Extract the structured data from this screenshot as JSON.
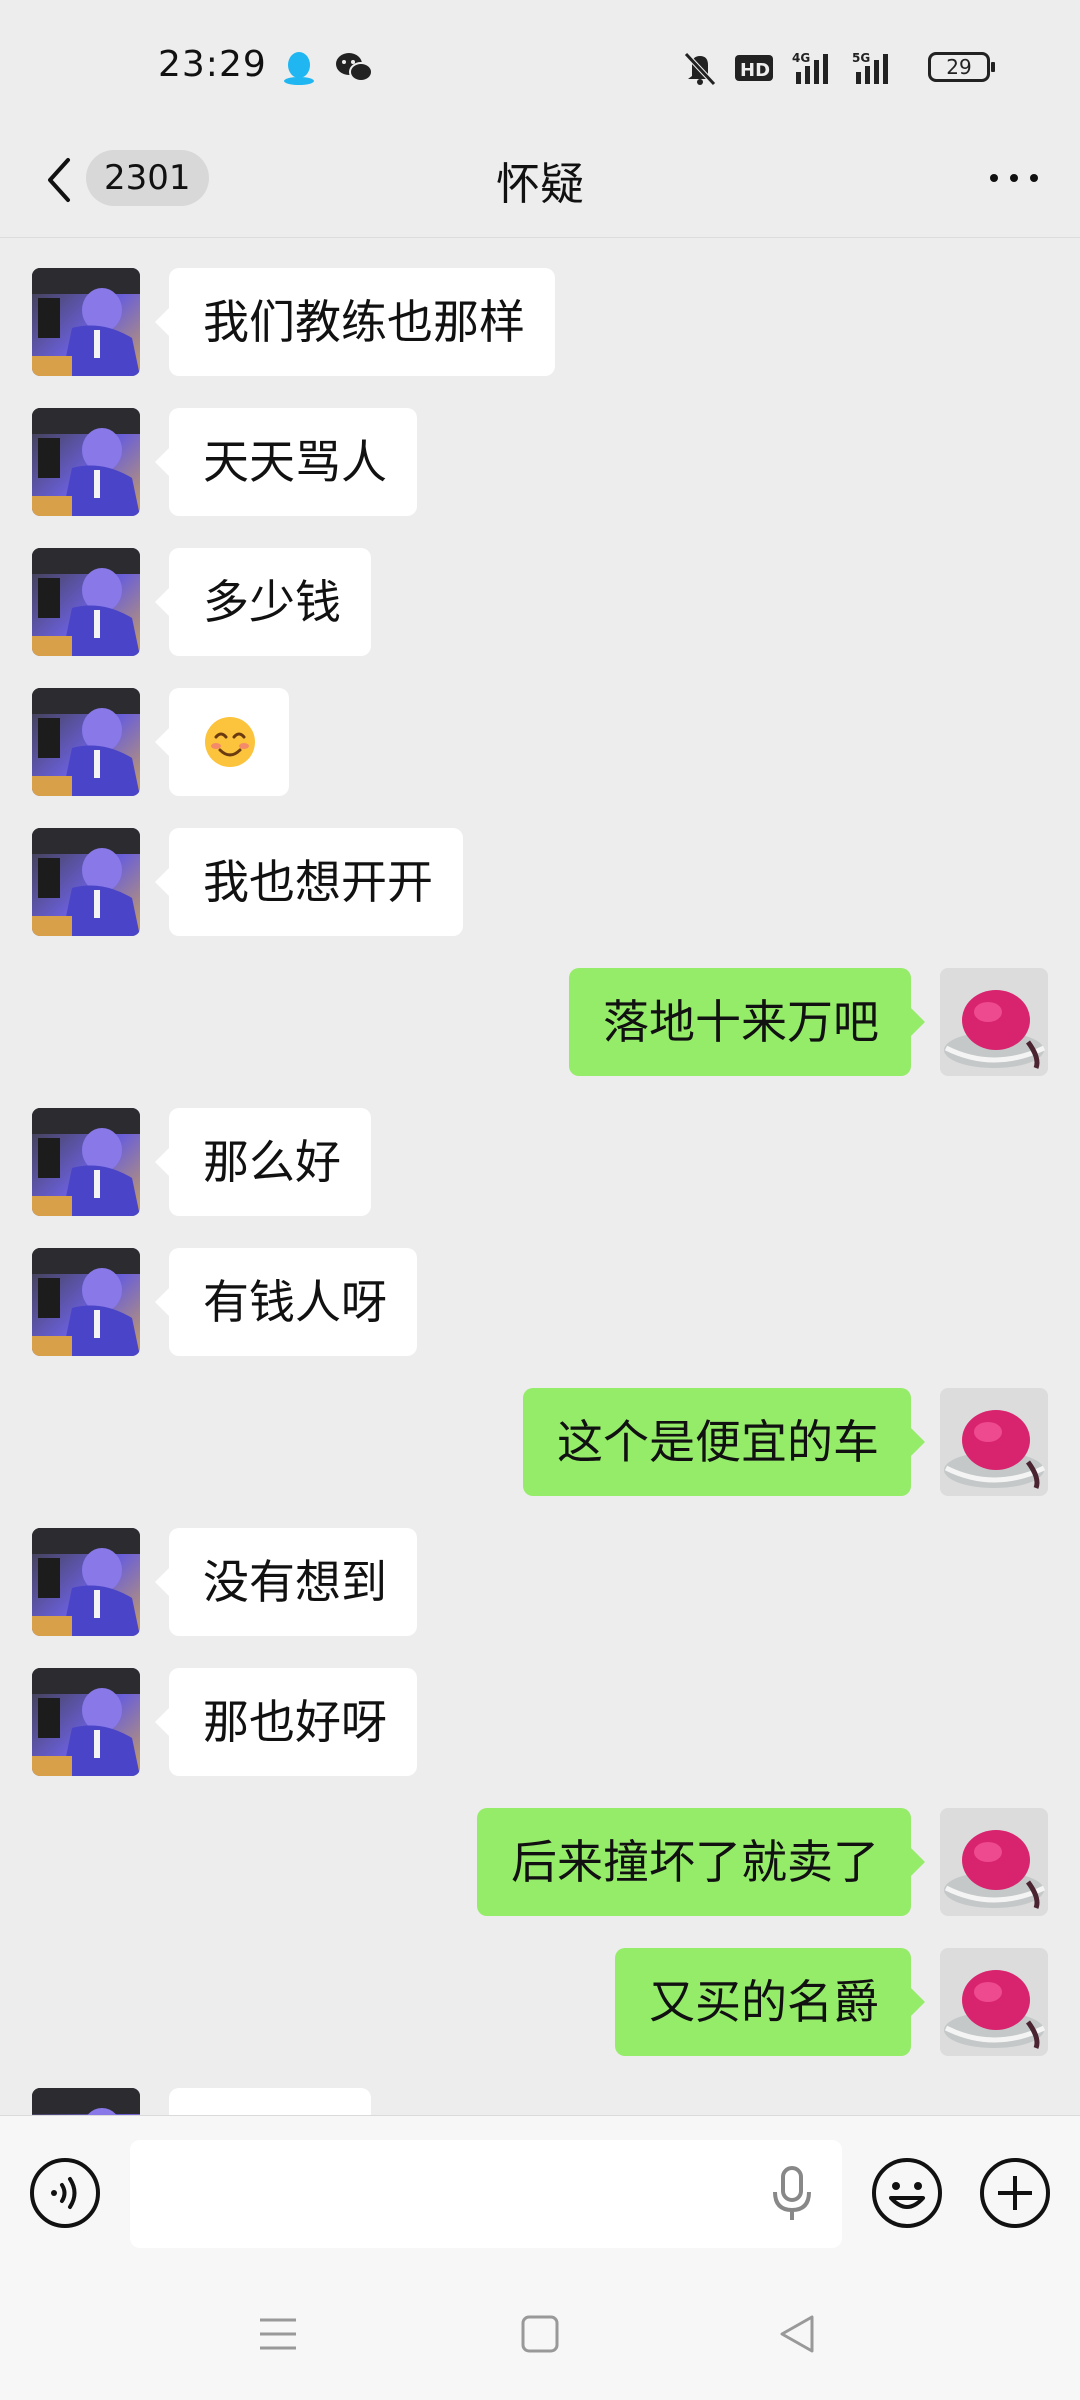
{
  "status_bar": {
    "time": "23:29",
    "icons": [
      "qq-icon",
      "wechat-icon",
      "mute-icon",
      "hd-icon",
      "signal-4g-icon",
      "signal-5g-icon"
    ],
    "battery": "29"
  },
  "nav": {
    "unread_count": "2301",
    "title": "怀疑"
  },
  "messages": [
    {
      "side": "left",
      "text": "我们教练也那样"
    },
    {
      "side": "left",
      "text": "天天骂人"
    },
    {
      "side": "left",
      "text": "多少钱"
    },
    {
      "side": "left",
      "text": "",
      "emoji": "smiling-face-emoji"
    },
    {
      "side": "left",
      "text": "我也想开开"
    },
    {
      "side": "right",
      "text": "落地十来万吧"
    },
    {
      "side": "left",
      "text": "那么好"
    },
    {
      "side": "left",
      "text": "有钱人呀"
    },
    {
      "side": "right",
      "text": "这个是便宜的车"
    },
    {
      "side": "left",
      "text": "没有想到"
    },
    {
      "side": "left",
      "text": "那也好呀"
    },
    {
      "side": "right",
      "text": "后来撞坏了就卖了"
    },
    {
      "side": "right",
      "text": "又买的名爵"
    },
    {
      "side": "left",
      "text": ""
    }
  ],
  "colors": {
    "background": "#ededed",
    "bubble_self": "#95ec69",
    "bubble_other": "#ffffff"
  }
}
